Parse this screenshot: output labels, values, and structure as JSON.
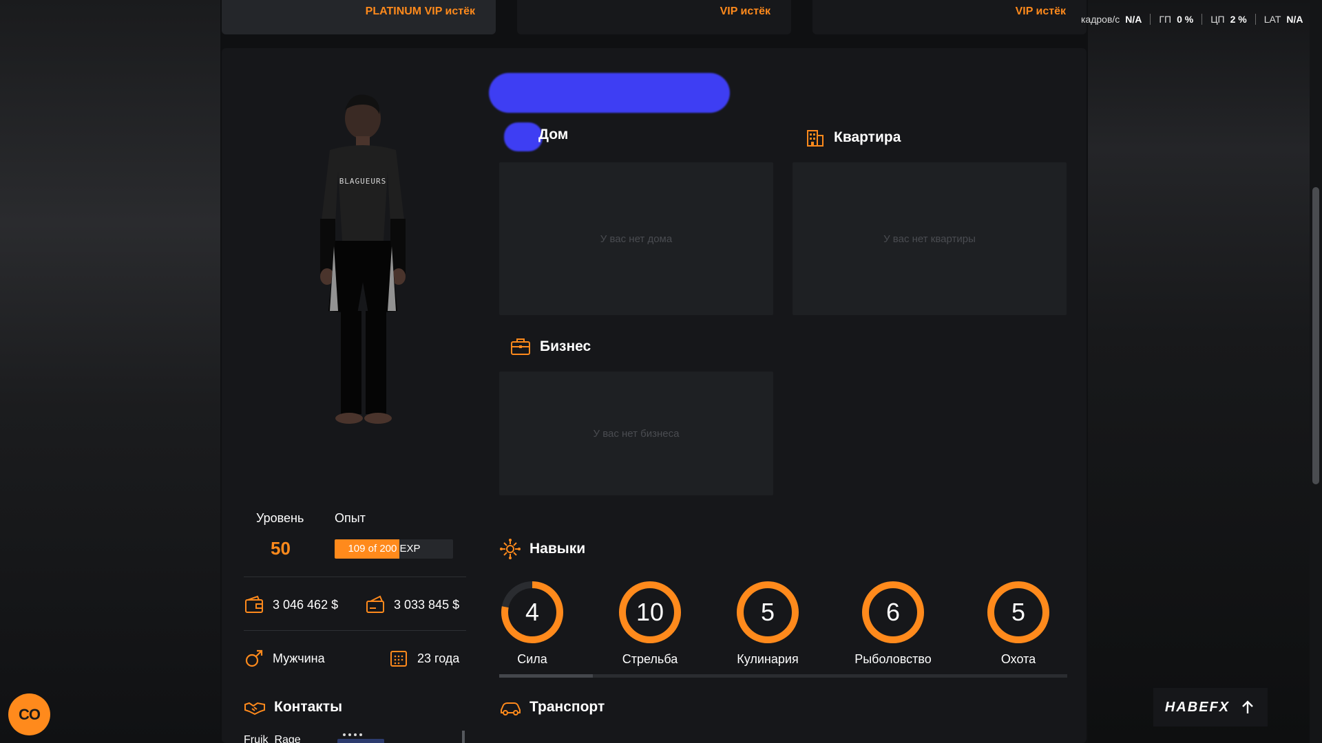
{
  "top_cards": [
    {
      "label": "PLATINUM VIP истёк"
    },
    {
      "label": "VIP истёк"
    },
    {
      "label": "VIP истёк"
    }
  ],
  "perf": {
    "fps_label": "кадров/с",
    "fps_value": "N/A",
    "gpu_label": "ГП",
    "gpu_value": "0 %",
    "cpu_label": "ЦП",
    "cpu_value": "2 %",
    "lat_label": "LAT",
    "lat_value": "N/A"
  },
  "character": {
    "shirt_text": "BLAGUEURS",
    "level_label": "Уровень",
    "level_value": "50",
    "exp_label": "Опыт",
    "exp_text": "109 of 200 EXP",
    "exp_fraction": 0.545,
    "cash": "3 046 462 $",
    "bank": "3 033 845 $",
    "gender": "Мужчина",
    "age": "23 года"
  },
  "property": {
    "house_title": "Дом",
    "house_empty": "У вас нет дома",
    "apartment_title": "Квартира",
    "apartment_empty": "У вас нет квартиры",
    "business_title": "Бизнес",
    "business_empty": "У вас нет бизнеса"
  },
  "skills": {
    "title": "Навыки",
    "items": [
      {
        "name": "Сила",
        "value": "4",
        "progress": 0.78
      },
      {
        "name": "Стрельба",
        "value": "10",
        "progress": 1.0
      },
      {
        "name": "Кулинария",
        "value": "5",
        "progress": 1.0
      },
      {
        "name": "Рыболовство",
        "value": "6",
        "progress": 1.0
      },
      {
        "name": "Охота",
        "value": "5",
        "progress": 1.0
      }
    ]
  },
  "contacts": {
    "title": "Контакты",
    "first": "Fruik_Rage"
  },
  "transport": {
    "title": "Транспорт"
  },
  "buttons": {
    "co": "CO",
    "hud": "HABEFX"
  },
  "colors": {
    "accent": "#ff8a1c",
    "panel": "#16171a",
    "box": "#1e2023"
  }
}
